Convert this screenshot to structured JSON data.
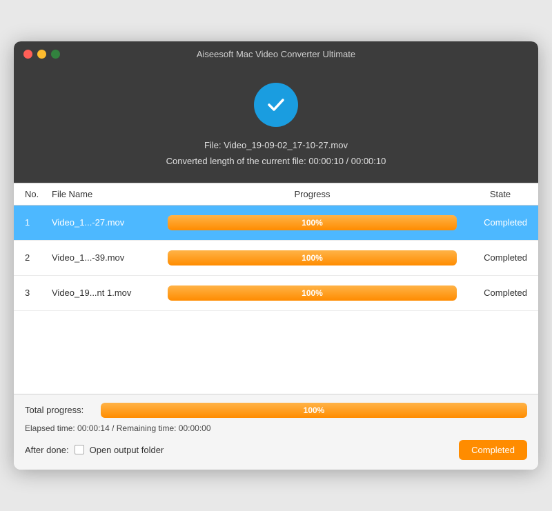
{
  "window": {
    "title": "Aiseesoft Mac Video Converter Ultimate"
  },
  "hero": {
    "file_label": "File: Video_19-09-02_17-10-27.mov",
    "converted_length": "Converted length of the current file: 00:00:10 / 00:00:10"
  },
  "table": {
    "headers": {
      "no": "No.",
      "file_name": "File Name",
      "progress": "Progress",
      "state": "State"
    },
    "rows": [
      {
        "no": "1",
        "file_name": "Video_1...-27.mov",
        "progress": 100,
        "progress_label": "100%",
        "state": "Completed",
        "selected": true
      },
      {
        "no": "2",
        "file_name": "Video_1...-39.mov",
        "progress": 100,
        "progress_label": "100%",
        "state": "Completed",
        "selected": false
      },
      {
        "no": "3",
        "file_name": "Video_19...nt 1.mov",
        "progress": 100,
        "progress_label": "100%",
        "state": "Completed",
        "selected": false
      }
    ]
  },
  "footer": {
    "total_progress_label": "Total progress:",
    "total_progress_value": 100,
    "total_progress_display": "100%",
    "elapsed": "Elapsed time: 00:00:14 / Remaining time: 00:00:00",
    "after_done_label": "After done:",
    "open_output_label": "Open output folder",
    "completed_button": "Completed"
  },
  "colors": {
    "accent_orange": "#ff8c00",
    "accent_blue": "#1a9de0",
    "selected_row": "#4db8ff"
  }
}
